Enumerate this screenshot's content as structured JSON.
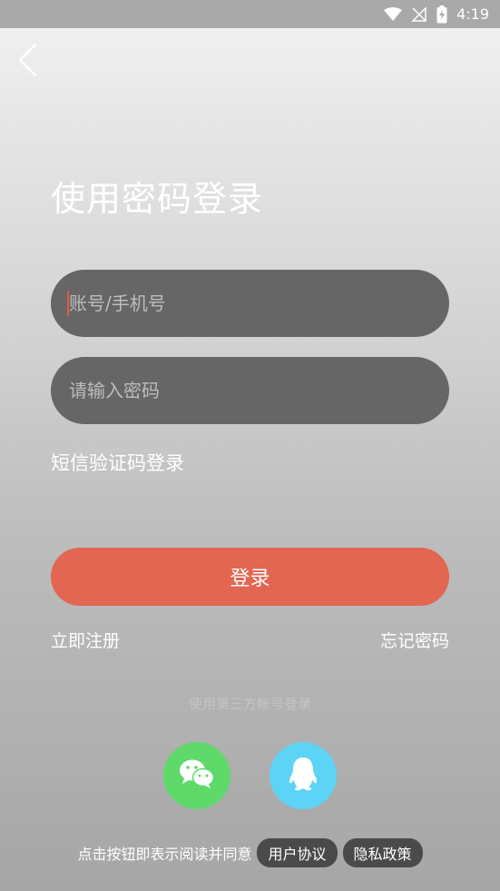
{
  "status_bar": {
    "time": "4:19",
    "icons": [
      "wifi-icon",
      "no-signal-icon",
      "battery-charging-icon"
    ]
  },
  "header": {
    "back_icon": "chevron-left-icon"
  },
  "title": "使用密码登录",
  "form": {
    "account_placeholder": "账号/手机号",
    "password_placeholder": "请输入密码",
    "sms_login": "短信验证码登录",
    "login_button": "登录",
    "register": "立即注册",
    "forgot_password": "忘记密码"
  },
  "third_party": {
    "label": "使用第三方帐号登录",
    "wechat_icon": "wechat-icon",
    "qq_icon": "qq-icon"
  },
  "agreement": {
    "text": "点击按钮即表示阅读并同意",
    "user_agreement": "用户协议",
    "privacy_policy": "隐私政策"
  },
  "colors": {
    "accent": "#e26651",
    "field_bg": "#666666",
    "wechat": "#5fd96a",
    "qq": "#5dd3f5"
  }
}
